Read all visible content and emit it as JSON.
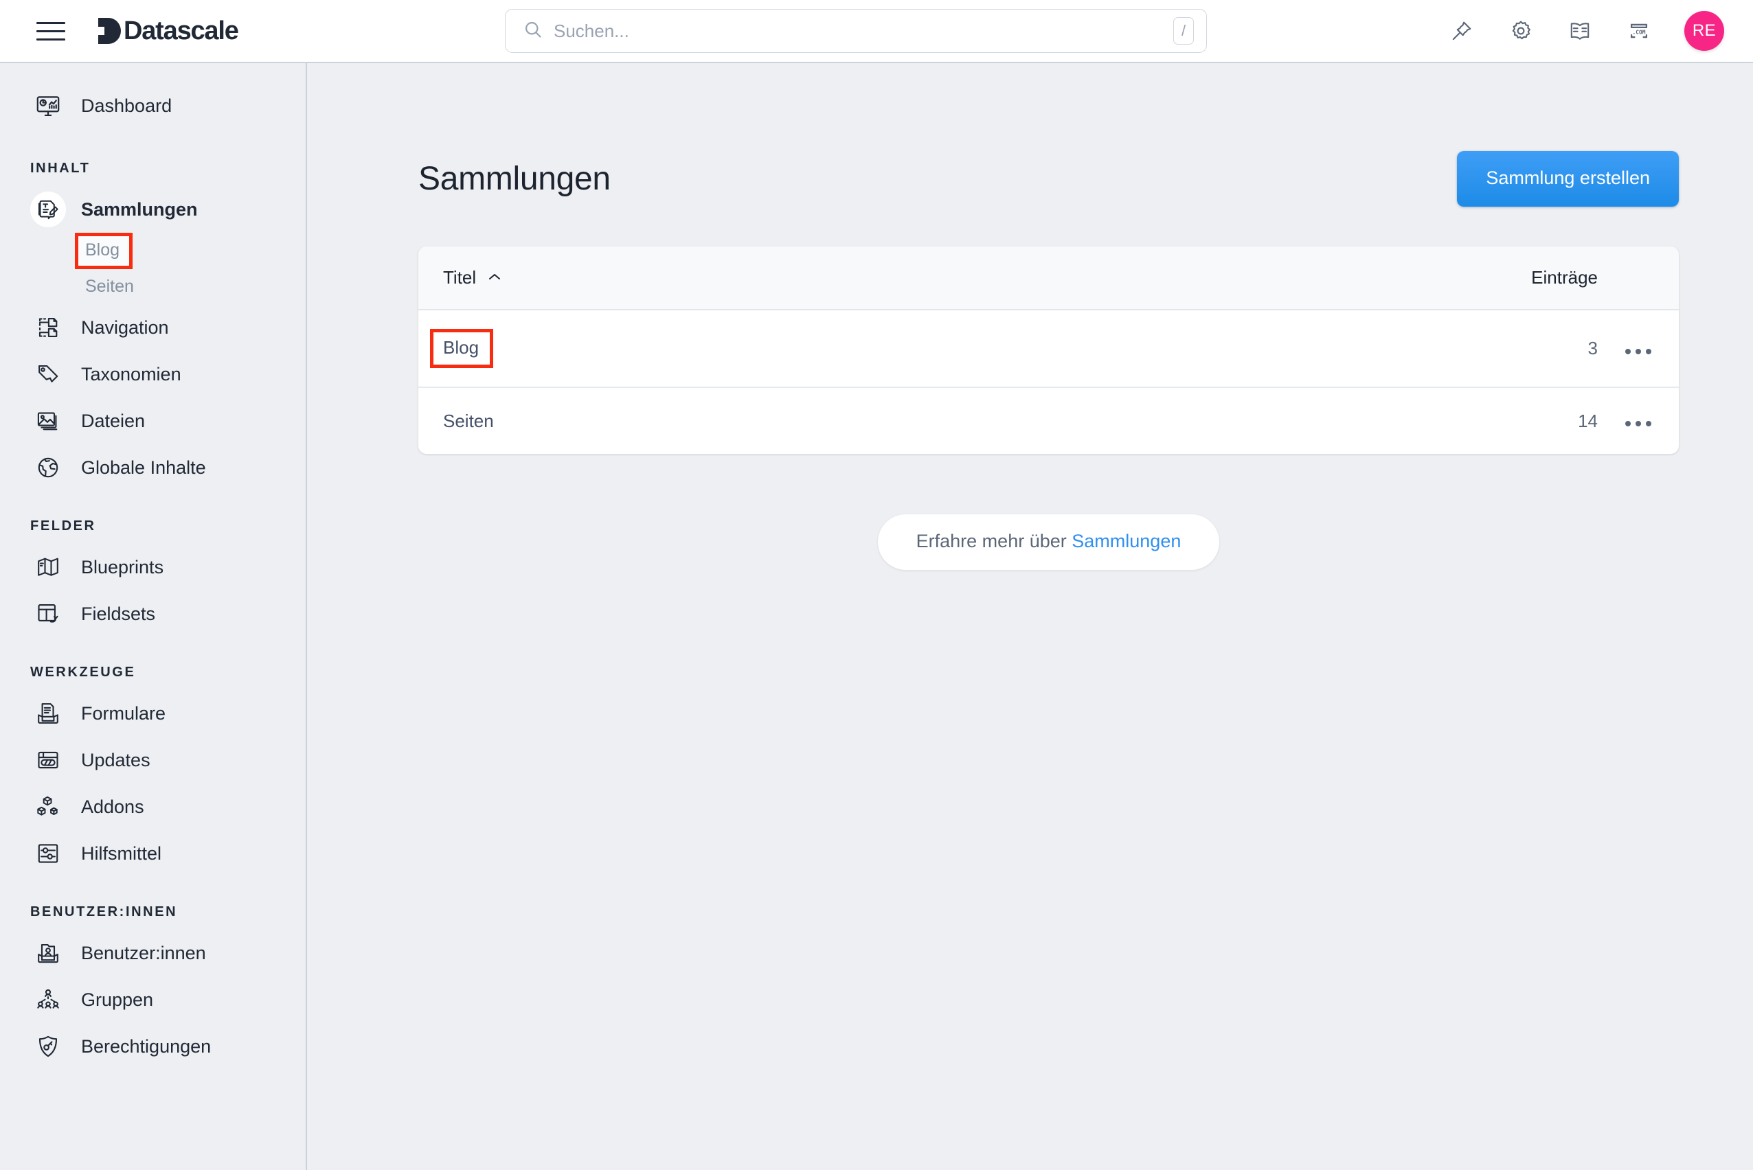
{
  "header": {
    "menu_icon": "hamburger-icon",
    "brand": "Datascale",
    "search": {
      "placeholder": "Suchen...",
      "icon": "search-icon",
      "shortcut": "/"
    },
    "actions": [
      {
        "icon": "pin-icon",
        "name": "pin"
      },
      {
        "icon": "gear-icon",
        "name": "settings"
      },
      {
        "icon": "book-icon",
        "name": "documentation"
      },
      {
        "icon": "dotcom-icon",
        "name": "site",
        "label": ".COM"
      }
    ],
    "avatar": {
      "initials": "RE",
      "color": "#f72585"
    }
  },
  "sidebar": {
    "top": [
      {
        "label": "Dashboard",
        "icon": "dashboard-icon"
      }
    ],
    "sections": [
      {
        "title": "INHALT",
        "items": [
          {
            "label": "Sammlungen",
            "icon": "collections-icon",
            "active": true,
            "children": [
              {
                "label": "Blog",
                "highlighted": true
              },
              {
                "label": "Seiten",
                "highlighted": false
              }
            ]
          },
          {
            "label": "Navigation",
            "icon": "sitemap-icon"
          },
          {
            "label": "Taxonomien",
            "icon": "tag-icon"
          },
          {
            "label": "Dateien",
            "icon": "images-icon"
          },
          {
            "label": "Globale Inhalte",
            "icon": "globe-icon"
          }
        ]
      },
      {
        "title": "FELDER",
        "items": [
          {
            "label": "Blueprints",
            "icon": "map-icon"
          },
          {
            "label": "Fieldsets",
            "icon": "fieldset-icon"
          }
        ]
      },
      {
        "title": "WERKZEUGE",
        "items": [
          {
            "label": "Formulare",
            "icon": "form-inbox-icon"
          },
          {
            "label": "Updates",
            "icon": "window-icon"
          },
          {
            "label": "Addons",
            "icon": "cubes-icon"
          },
          {
            "label": "Hilfsmittel",
            "icon": "sliders-icon"
          }
        ]
      },
      {
        "title": "BENUTZER:INNEN",
        "items": [
          {
            "label": "Benutzer:innen",
            "icon": "user-inbox-icon"
          },
          {
            "label": "Gruppen",
            "icon": "group-icon"
          },
          {
            "label": "Berechtigungen",
            "icon": "shield-key-icon"
          }
        ]
      }
    ]
  },
  "main": {
    "title": "Sammlungen",
    "create_button": "Sammlung erstellen",
    "table": {
      "columns": {
        "title": "Titel",
        "count": "Einträge",
        "sort": "ascending"
      },
      "rows": [
        {
          "title": "Blog",
          "count": "3",
          "highlighted": true,
          "menu": "row-actions"
        },
        {
          "title": "Seiten",
          "count": "14",
          "highlighted": false,
          "menu": "row-actions"
        }
      ]
    },
    "learn_more": {
      "prefix": "Erfahre mehr über",
      "link": "Sammlungen"
    }
  },
  "colors": {
    "accent_blue": "#2f8ff0",
    "avatar_pink": "#f72585",
    "highlight_red": "#f82c10",
    "app_bg": "#edeff2"
  }
}
